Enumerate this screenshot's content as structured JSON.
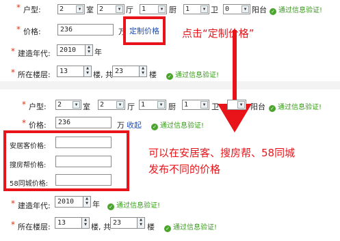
{
  "top": {
    "huxing_label": "户型:",
    "shi_value": "2",
    "shi_unit": "室",
    "ting_value": "2",
    "ting_unit": "厅",
    "chu_value": "1",
    "chu_unit": "厨",
    "wei_value": "1",
    "wei_unit": "卫",
    "yangtai_value": "0",
    "yangtai_unit": "阳台",
    "huxing_ok": "通过信息验证!",
    "price_label": "价格:",
    "price_value": "236",
    "price_unit": "万",
    "custom_price_link": "定制价格",
    "year_label": "建造年代:",
    "year_value": "2010",
    "year_unit": "年",
    "floor_label": "所在楼层:",
    "floor_value": "13",
    "floor_mid": "楼, 共",
    "floor_total": "23",
    "floor_unit": "楼",
    "floor_ok": "通过信息验证!"
  },
  "annotation_click": "点击“定制价格”",
  "bottom": {
    "huxing_label": "户型:",
    "shi_value": "2",
    "shi_unit": "室",
    "ting_value": "2",
    "ting_unit": "厅",
    "chu_value": "1",
    "chu_unit": "厨",
    "wei_value": "1",
    "wei_unit": "卫",
    "yangtai_unit": "阳台",
    "huxing_ok": "通过信息验证!",
    "price_label": "价格:",
    "price_value": "236",
    "price_unit": "万",
    "collapse_link": "收起",
    "price_ok": "通过信息验证!",
    "anjuke_label": "安居客价格:",
    "soufang_label": "搜房帮价格:",
    "tongcheng_label": "58同城价格:",
    "year_label": "建造年代:",
    "year_value": "2010",
    "year_unit": "年",
    "year_ok": "通过信息验证!",
    "floor_label": "所在楼层:",
    "floor_value": "13",
    "floor_mid": "楼, 共",
    "floor_total": "23",
    "floor_unit": "楼",
    "floor_ok": "通过信息验证!"
  },
  "annotation_publish": [
    "可以在安居客、搜房帮、58同城",
    "发布不同的价格"
  ],
  "colors": {
    "accent_red": "#e8141a",
    "ok_green": "#3a9a1c",
    "link_blue": "#1d4db5"
  },
  "icons": {
    "ok": "check-circle-icon",
    "arrow": "down-arrow-annotation-icon"
  }
}
